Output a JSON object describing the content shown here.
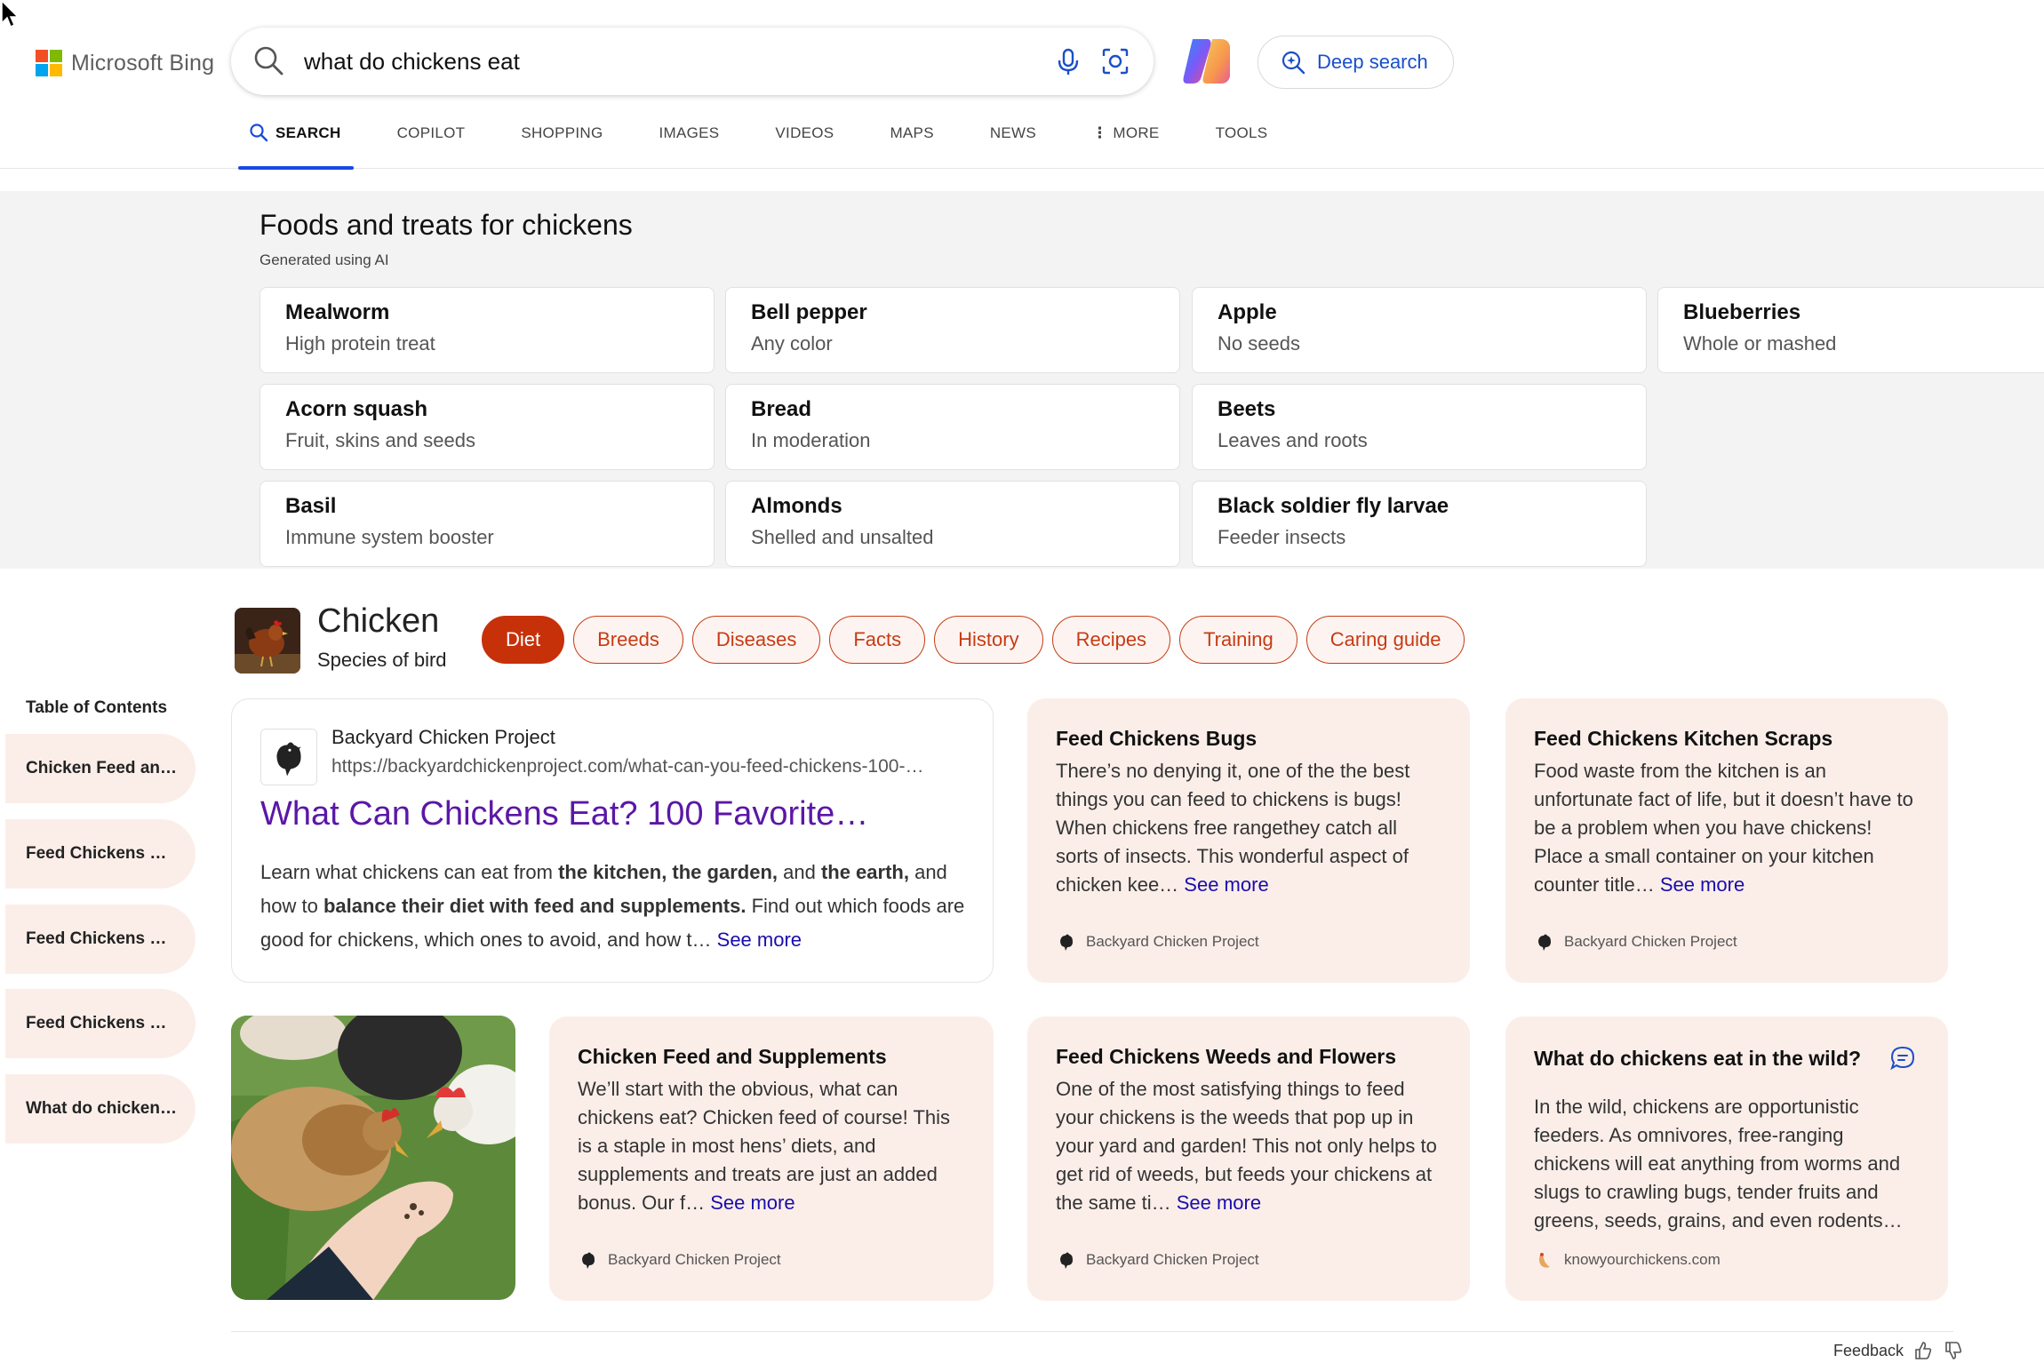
{
  "brand": {
    "logo_text": "Microsoft Bing",
    "colors": [
      "#f25022",
      "#7fba00",
      "#00a4ef",
      "#ffb900"
    ]
  },
  "search": {
    "query": "what do chickens eat",
    "icon": "search-icon"
  },
  "deep_search": {
    "label": "Deep search"
  },
  "tabs": [
    {
      "label": "SEARCH",
      "active": true
    },
    {
      "label": "COPILOT"
    },
    {
      "label": "SHOPPING"
    },
    {
      "label": "IMAGES"
    },
    {
      "label": "VIDEOS"
    },
    {
      "label": "MAPS"
    },
    {
      "label": "NEWS"
    },
    {
      "label": "MORE"
    },
    {
      "label": "TOOLS"
    }
  ],
  "treats": {
    "title": "Foods and treats for chickens",
    "subtitle": "Generated using AI",
    "items": [
      {
        "title": "Mealworm",
        "sub": "High protein treat"
      },
      {
        "title": "Bell pepper",
        "sub": "Any color"
      },
      {
        "title": "Apple",
        "sub": "No seeds"
      },
      {
        "title": "Blueberries",
        "sub": "Whole or mashed"
      },
      {
        "title": "Acorn squash",
        "sub": "Fruit, skins and seeds"
      },
      {
        "title": "Bread",
        "sub": "In moderation"
      },
      {
        "title": "Beets",
        "sub": "Leaves and roots"
      },
      {
        "title": "Basil",
        "sub": "Immune system booster"
      },
      {
        "title": "Almonds",
        "sub": "Shelled and unsalted"
      },
      {
        "title": "Black soldier fly larvae",
        "sub": "Feeder insects"
      }
    ]
  },
  "entity": {
    "title": "Chicken",
    "subtitle": "Species of bird",
    "pills": [
      "Diet",
      "Breeds",
      "Diseases",
      "Facts",
      "History",
      "Recipes",
      "Training",
      "Caring guide"
    ]
  },
  "toc": {
    "title": "Table of Contents",
    "items": [
      "Chicken Feed an…",
      "Feed Chickens …",
      "Feed Chickens …",
      "Feed Chickens …",
      "What do chicken…"
    ]
  },
  "main_result": {
    "site": "Backyard Chicken Project",
    "url": "https://backyardchickenproject.com/what-can-you-feed-chickens-100-…",
    "title": "What Can Chickens Eat? 100 Favorite…",
    "desc_1": "Learn what chickens can eat from ",
    "desc_b1": "the kitchen, the garden,",
    "desc_2": " and ",
    "desc_b2": "the earth,",
    "desc_3": " and how to ",
    "desc_b3": "balance their diet with feed and supplements.",
    "desc_4": " Find out which foods are good for chickens, which ones to avoid, and how t… ",
    "see_more": "See more"
  },
  "cards": {
    "bugs": {
      "title": "Feed Chickens Bugs",
      "body": "There’s no denying it, one of the the best things you can feed to chickens is bugs! When chickens free rangethey catch all sorts of insects. This wonderful aspect of chicken kee… ",
      "see_more": "See more",
      "source": "Backyard Chicken Project"
    },
    "scraps": {
      "title": "Feed Chickens Kitchen Scraps",
      "body": "Food waste from the kitchen is an unfortunate fact of life, but it doesn’t have to be a problem when you have chickens! Place a small container on your kitchen counter title… ",
      "see_more": "See more",
      "source": "Backyard Chicken Project"
    },
    "feed": {
      "title": "Chicken Feed and Supplements",
      "body": "We’ll start with the obvious, what can chickens eat? Chicken feed of course! This is a staple in most hens’ diets, and supplements and treats are just an added bonus. Our f… ",
      "see_more": "See more",
      "source": "Backyard Chicken Project"
    },
    "weeds": {
      "title": "Feed Chickens Weeds and Flowers",
      "body": "One of the most satisfying things to feed your chickens is the weeds that pop up in your yard and garden! This not only helps to get rid of weeds, but feeds your chickens at the same ti… ",
      "see_more": "See more",
      "source": "Backyard Chicken Project"
    },
    "wild": {
      "title": "What do chickens eat in the wild?",
      "body": "In the wild, chickens are opportunistic feeders. As omnivores, free-ranging chickens will eat anything from worms and slugs to crawling bugs, tender fruits and greens, seeds, grains, and even rodents…",
      "source": "knowyourchickens.com"
    }
  },
  "footer": {
    "feedback": "Feedback"
  }
}
